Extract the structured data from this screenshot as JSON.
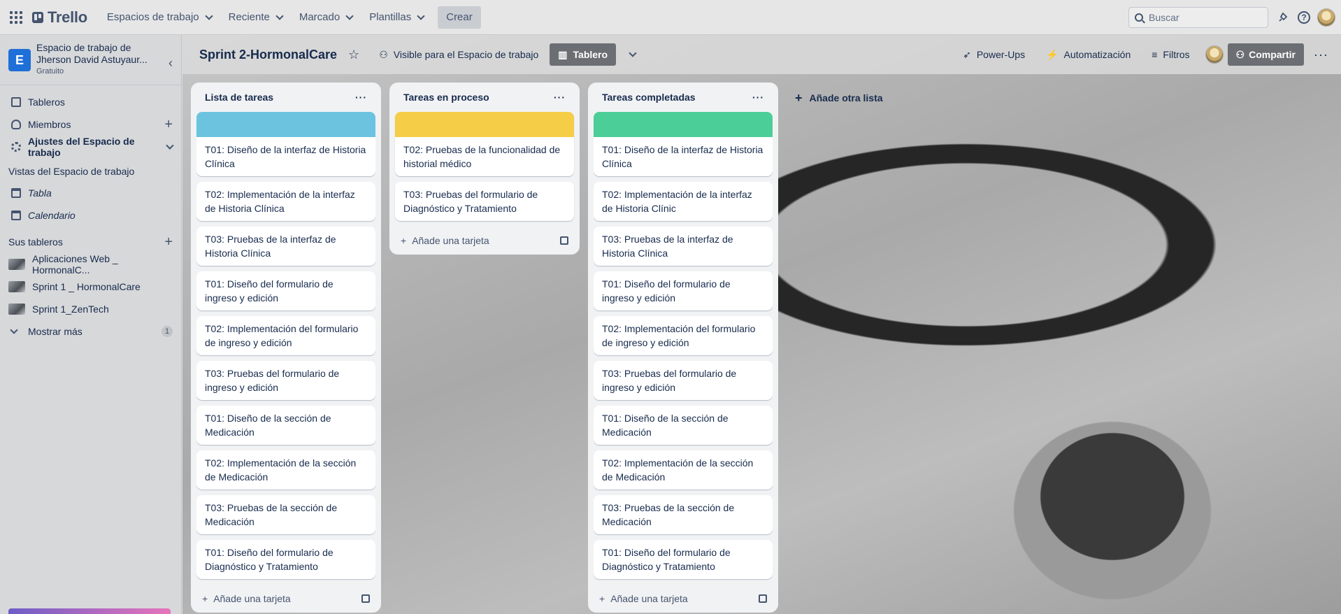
{
  "topbar": {
    "brand": "Trello",
    "nav": [
      {
        "label": "Espacios de trabajo"
      },
      {
        "label": "Reciente"
      },
      {
        "label": "Marcado"
      },
      {
        "label": "Plantillas"
      }
    ],
    "create_label": "Crear",
    "search_placeholder": "Buscar",
    "help_icon": "?"
  },
  "sidebar": {
    "workspace_initial": "E",
    "workspace_name": "Espacio de trabajo de Jherson David Astuyaur...",
    "workspace_plan": "Gratuito",
    "items": [
      {
        "label": "Tableros"
      },
      {
        "label": "Miembros"
      },
      {
        "label": "Ajustes del Espacio de trabajo"
      }
    ],
    "views_title": "Vistas del Espacio de trabajo",
    "views": [
      {
        "label": "Tabla"
      },
      {
        "label": "Calendario"
      }
    ],
    "boards_title": "Sus tableros",
    "boards": [
      {
        "label": "Aplicaciones Web _ HormonalC..."
      },
      {
        "label": "Sprint 1 _ HormonalCare"
      },
      {
        "label": "Sprint 1_ZenTech"
      }
    ],
    "show_more": "Mostrar más",
    "show_more_count": "1"
  },
  "board": {
    "title": "Sprint 2-HormonalCare",
    "visibility": "Visible para el Espacio de trabajo",
    "view_label": "Tablero",
    "powerups": "Power-Ups",
    "automation": "Automatización",
    "filters": "Filtros",
    "share": "Compartir",
    "add_list": "Añade otra lista"
  },
  "lists": [
    {
      "title": "Lista de tareas",
      "cover_color": "#6cc3e0",
      "add_card": "Añade una tarjeta",
      "cards": [
        "T01: Diseño de la interfaz de Historia Clínica",
        "T02: Implementación de la interfaz de Historia Clínica",
        "T03: Pruebas de la interfaz de Historia Clínica",
        "T01: Diseño del formulario de ingreso y edición",
        "T02: Implementación del formulario de ingreso y edición",
        "T03: Pruebas del formulario de ingreso y edición",
        "T01: Diseño de la sección de Medicación",
        "T02: Implementación de la sección de Medicación",
        "T03: Pruebas de la sección de Medicación",
        "T01: Diseño del formulario de Diagnóstico y Tratamiento"
      ]
    },
    {
      "title": "Tareas en proceso",
      "cover_color": "#f5cd47",
      "add_card": "Añade una tarjeta",
      "cards": [
        "T02: Pruebas de la funcionalidad de historial médico",
        "T03: Pruebas del formulario de Diagnóstico y Tratamiento"
      ]
    },
    {
      "title": "Tareas completadas",
      "cover_color": "#4bce97",
      "add_card": "Añade una tarjeta",
      "cards": [
        "T01: Diseño de la interfaz de Historia Clínica",
        "T02: Implementación de la interfaz de Historia Clínic",
        "T03: Pruebas de la interfaz de Historia Clínica",
        "T01: Diseño del formulario de ingreso y edición",
        "T02: Implementación del formulario de ingreso y edición",
        "T03: Pruebas del formulario de ingreso y edición",
        "T01: Diseño de la sección de Medicación",
        "T02: Implementación de la sección de Medicación",
        "T03: Pruebas de la sección de Medicación",
        "T01: Diseño del formulario de Diagnóstico y Tratamiento"
      ]
    }
  ]
}
